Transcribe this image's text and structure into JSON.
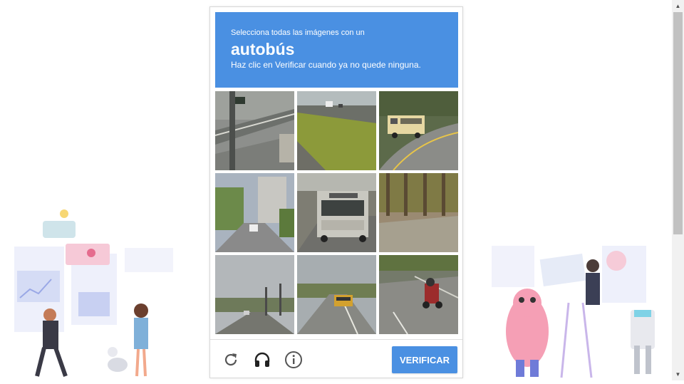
{
  "challenge": {
    "instruction_small": "Selecciona todas las imágenes con un",
    "target": "autobús",
    "instruction_sub": "Haz clic en Verificar cuando ya no quede ninguna."
  },
  "tiles": [
    {
      "name": "traffic-light-pole"
    },
    {
      "name": "highway-grass-median"
    },
    {
      "name": "school-bus-curve"
    },
    {
      "name": "palm-street-buildings"
    },
    {
      "name": "city-bus-road"
    },
    {
      "name": "trees-roadside"
    },
    {
      "name": "road-street-lights"
    },
    {
      "name": "school-bus-far"
    },
    {
      "name": "motorcycle-road"
    }
  ],
  "controls": {
    "reload_icon": "reload-icon",
    "audio_icon": "headphones-icon",
    "info_icon": "info-icon",
    "verify_label": "VERIFICAR"
  },
  "colors": {
    "accent": "#4a90e2",
    "text_on_accent": "#ffffff"
  }
}
